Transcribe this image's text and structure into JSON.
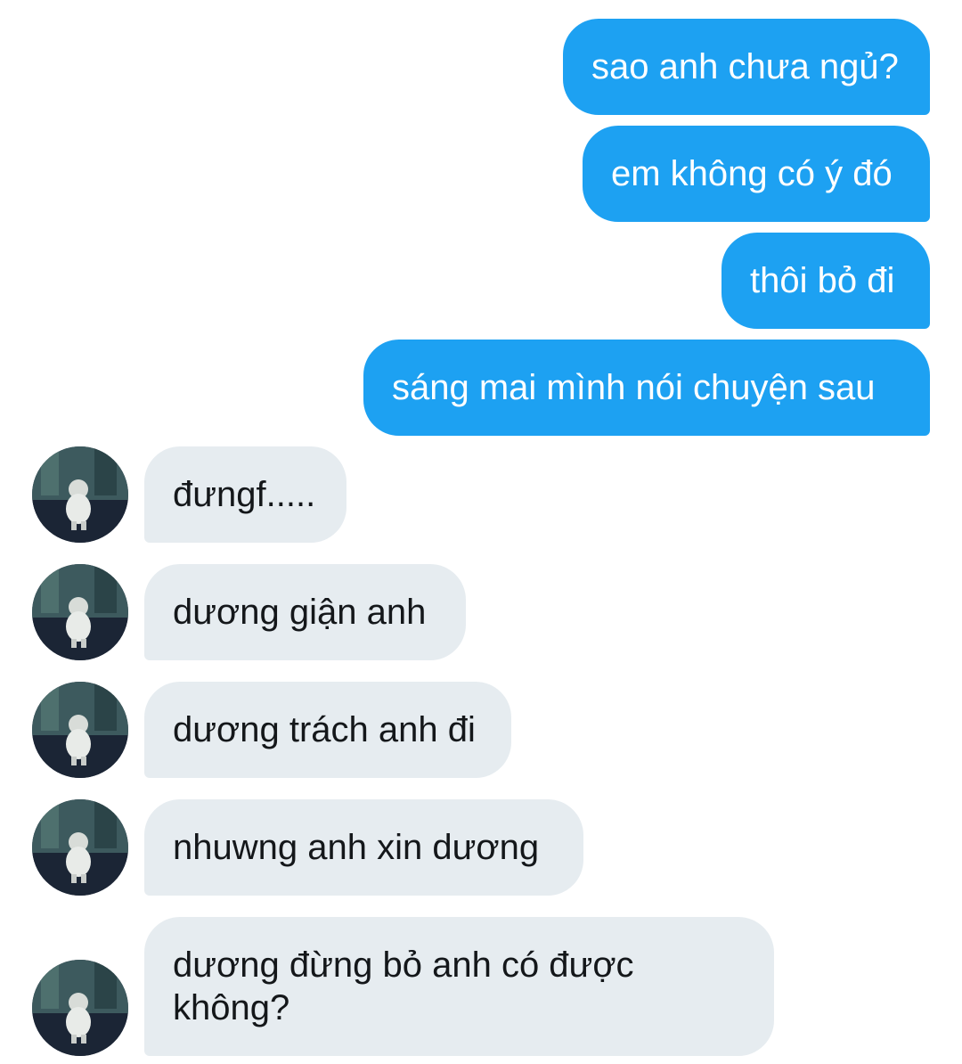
{
  "conversation": {
    "sent": [
      {
        "text": "sao anh chưa ngủ?"
      },
      {
        "text": "em không có ý đó"
      },
      {
        "text": "thôi bỏ đi"
      },
      {
        "text": "sáng mai mình nói chuyện sau"
      }
    ],
    "received": [
      {
        "text": "đưngf....."
      },
      {
        "text": "dương giận anh"
      },
      {
        "text": "dương trách anh đi"
      },
      {
        "text": "nhuwng anh xin dương"
      },
      {
        "text": "dương đừng bỏ anh có được không?"
      }
    ]
  },
  "colors": {
    "sent_bubble": "#1da1f2",
    "received_bubble": "#e6ecf0"
  }
}
